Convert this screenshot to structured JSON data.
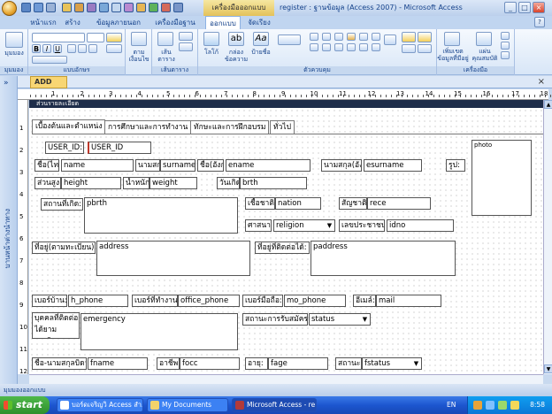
{
  "window": {
    "title": "register : ฐานข้อมูล (Access 2007) - Microsoft Access",
    "context_tab": "เครื่องมือออกแบบฟอร์ม"
  },
  "ribbon": {
    "tabs": [
      "หน้าแรก",
      "สร้าง",
      "ข้อมูลภายนอก",
      "เครื่องมือฐานข้อมูล",
      "ออกแบบ",
      "จัดเรียง"
    ],
    "active_tab": "ออกแบบ",
    "groups": [
      {
        "label": "มุมมอง",
        "buttons": [
          "มุมมอง"
        ]
      },
      {
        "label": "แบบอักษร",
        "buttons": []
      },
      {
        "label": "",
        "buttons": [
          "ตาม เงื่อนไข"
        ]
      },
      {
        "label": "เส้นตาราง",
        "buttons": [
          "เส้นตาราง"
        ]
      },
      {
        "label": "ตัวควบคุม",
        "buttons": [
          "โลโก้",
          "กล่องข้อความ",
          "ป้ายชื่อ"
        ]
      },
      {
        "label": "เครื่องมือ",
        "buttons": [
          "เพิ่มเขตข้อมูลที่มีอยู่",
          "แผ่น คุณสมบัติ"
        ]
      }
    ]
  },
  "nav_pane": {
    "label": "บานหน้าต่างนำทาง"
  },
  "document": {
    "tab": "ADD",
    "section": "ส่วนรายละเอียด",
    "ruler_numbers": [
      "1",
      "2",
      "3",
      "4",
      "5",
      "6",
      "7",
      "8",
      "9",
      "10",
      "11",
      "12",
      "13",
      "14",
      "15",
      "16",
      "17",
      "18"
    ],
    "vruler_numbers": [
      "1",
      "2",
      "3",
      "4",
      "5",
      "6",
      "7",
      "8",
      "9",
      "10",
      "11",
      "12"
    ]
  },
  "form": {
    "tabs": [
      "เบื้องต้นและตำแหน่ง",
      "การศึกษาและการทำงาน",
      "ทักษะและการฝึกอบรม",
      "ทั่วไป"
    ],
    "labels": {
      "user_id": "USER_ID:",
      "name": "ชื่อ(ไทย",
      "surname": "นามสกุล:",
      "ename": "ชื่อ(อังกฤ",
      "esurname": "นามสกุล(อัง",
      "photo": "รูป:",
      "height": "ส่วนสูง:",
      "weight": "น้ำหนัก:",
      "birth": "วันเกิด:",
      "pbirth": "สถานที่เกิด:",
      "nation": "เชื้อชาติ:",
      "race": "สัญชาติ:",
      "religion": "ศาสนา:",
      "idno": "เลขประชาชน:",
      "address": "ที่อยู่(ตามทะเบียน):",
      "paddress": "ที่อยู่ที่ติดต่อได้:",
      "h_phone": "เบอร์บ้าน:",
      "office_phone": "เบอร์ที่ทำงาน:",
      "mo_phone": "เบอร์มือถือ:",
      "mail": "อีเมล์:",
      "emergency": "บุคคลที่ติดต่อได้ยามฉุกเฉิน:",
      "status": "สถานะการรับสมัคร:",
      "fname": "ชื่อ-นามสกุลบิดา:",
      "focc": "อาชีพ:",
      "fage": "อายุ:",
      "fstatus": "สถานะ:"
    },
    "fields": {
      "user_id": "USER_ID",
      "name": "name",
      "surname": "surname",
      "ename": "ename",
      "esurname": "esurname",
      "photo": "photo",
      "height": "height",
      "weight": "weight",
      "birth": "brth",
      "pbirth": "pbrth",
      "nation": "nation",
      "race": "rece",
      "religion": "religion",
      "idno": "idno",
      "address": "address",
      "paddress": "paddress",
      "h_phone": "h_phone",
      "office_phone": "office_phone",
      "mo_phone": "mo_phone",
      "mail": "mail",
      "emergency": "emergency",
      "status": "status",
      "fname": "fname",
      "focc": "focc",
      "fage": "fage",
      "fstatus": "fstatus"
    }
  },
  "statusbar": {
    "text": "มุมมองออกแบบ"
  },
  "taskbar": {
    "start": "start",
    "tasks": [
      "บอร์ดเจริญวิ Access สำ...",
      "My Documents",
      "Microsoft Access - re..."
    ],
    "lang": "EN",
    "clock": "8:58"
  },
  "colors": {
    "ribbon_bg": "#d8e6f7",
    "section_bar": "#1e2d4a",
    "taskbar": "#1c56cf",
    "start": "#2e8f2c",
    "doc_tab": "#f8d673"
  }
}
